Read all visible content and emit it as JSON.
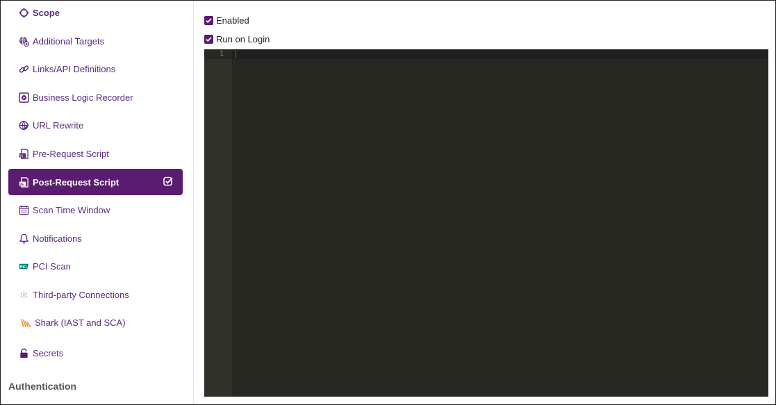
{
  "sidebar": {
    "items": [
      {
        "label": "Scope",
        "icon": "crosshair-icon"
      },
      {
        "label": "Additional Targets",
        "icon": "globe-plus-icon"
      },
      {
        "label": "Links/API Definitions",
        "icon": "link-icon"
      },
      {
        "label": "Business Logic Recorder",
        "icon": "record-icon"
      },
      {
        "label": "URL Rewrite",
        "icon": "globe-edit-icon"
      },
      {
        "label": "Pre-Request Script",
        "icon": "script-icon"
      },
      {
        "label": "Post-Request Script",
        "icon": "script-icon",
        "active": true
      },
      {
        "label": "Scan Time Window",
        "icon": "calendar-icon"
      },
      {
        "label": "Notifications",
        "icon": "bell-icon"
      },
      {
        "label": "PCI Scan",
        "icon": "pci-icon"
      },
      {
        "label": "Third-party Connections",
        "icon": "connections-icon"
      },
      {
        "label": "Shark (IAST and SCA)",
        "icon": "shark-icon"
      },
      {
        "label": "Secrets",
        "icon": "lock-icon"
      }
    ],
    "section_title": "Authentication"
  },
  "main": {
    "enabled_label": "Enabled",
    "enabled_checked": true,
    "run_on_login_label": "Run on Login",
    "run_on_login_checked": true,
    "editor": {
      "line_numbers": [
        "1"
      ],
      "content": ""
    }
  },
  "colors": {
    "accent": "#5a1c70",
    "link": "#5b2a86",
    "editor_bg": "#272822",
    "gutter_bg": "#2f3129"
  }
}
